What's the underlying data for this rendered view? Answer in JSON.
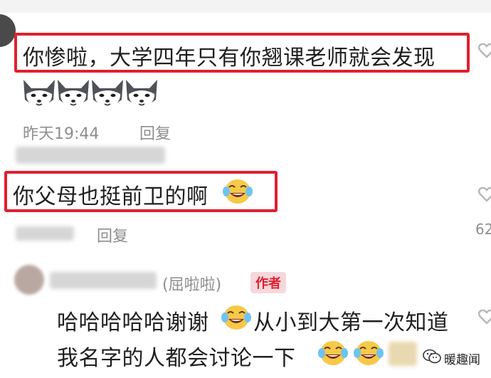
{
  "comment1": {
    "text": "你惨啦，大学四年只有你翘课老师就会发现",
    "emojis": [
      "husky-face",
      "husky-face",
      "husky-face",
      "husky-face"
    ],
    "time": "昨天19:44",
    "reply": "回复"
  },
  "comment2": {
    "text": "你父母也挺前卫的啊",
    "emoji": "laughing-tears-face",
    "reply": "回复",
    "likes": "62"
  },
  "comment3": {
    "tag": "(屈啦啦)",
    "badge": "作者",
    "line1_a": "哈哈哈哈哈谢谢",
    "line1_b": "从小到大第一次知道",
    "line2": "我名字的人都会讨论一下",
    "emoji": "laughing-tears-face"
  },
  "watermark": {
    "text": "暖趣闻",
    "icon": "wechat-icon"
  },
  "colors": {
    "highlight": "#e0202f",
    "meta_gray": "#8e8e8e",
    "badge_bg": "#f5d8dc"
  }
}
